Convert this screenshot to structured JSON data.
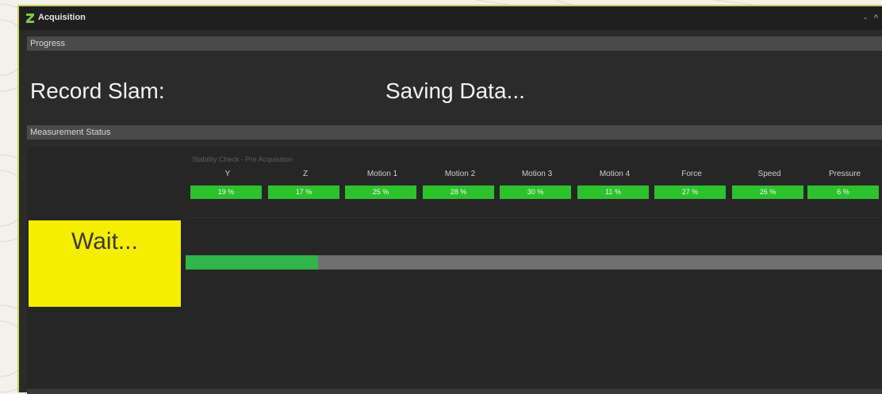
{
  "window": {
    "title": "Acquisition",
    "controls": "- ^"
  },
  "progress_section": {
    "header": "Progress",
    "record_label": "Record Slam:",
    "status_label": "Saving Data..."
  },
  "measurement_section": {
    "header": "Measurement Status",
    "stability_title": "Stability Check - Pre Acquisition",
    "channels": [
      {
        "label": "Y",
        "value": "19 %"
      },
      {
        "label": "Z",
        "value": "17 %"
      },
      {
        "label": "Motion 1",
        "value": "25 %"
      },
      {
        "label": "Motion 2",
        "value": "28 %"
      },
      {
        "label": "Motion 3",
        "value": "30 %"
      },
      {
        "label": "Motion 4",
        "value": "11 %"
      },
      {
        "label": "Force",
        "value": "27 %"
      },
      {
        "label": "Speed",
        "value": "26 %"
      },
      {
        "label": "Pressure",
        "value": "6 %"
      }
    ],
    "wait_label": "Wait...",
    "progress_fraction": 0.19
  },
  "colors": {
    "accent_border": "#c9d35a",
    "ok_green": "#2ec12e",
    "wait_yellow": "#f5ee00",
    "progress_green": "#2fb548"
  },
  "icons": {
    "app_logo": "z-logo-icon"
  }
}
